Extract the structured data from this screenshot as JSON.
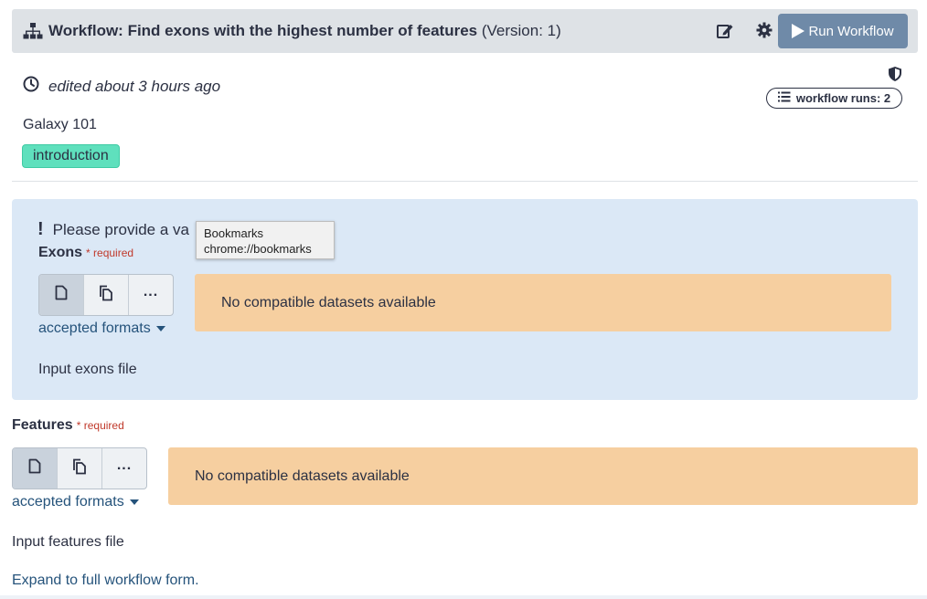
{
  "header": {
    "title": "Workflow: Find exons with the highest number of features",
    "version": "(Version: 1)",
    "run_label": "Run Workflow"
  },
  "meta": {
    "edited": "edited about 3 hours ago",
    "runs_badge": "workflow runs: 2",
    "creator": "Galaxy 101",
    "tag": "introduction"
  },
  "notice": {
    "text": "Please provide a va"
  },
  "tooltip": {
    "line1": "Bookmarks",
    "line2": "chrome://bookmarks"
  },
  "inputs": [
    {
      "label": "Exons",
      "required": "required",
      "formats": "accepted formats",
      "empty_message": "No compatible datasets available",
      "help": "Input exons file"
    },
    {
      "label": "Features",
      "required": "required",
      "formats": "accepted formats",
      "empty_message": "No compatible datasets available",
      "help": "Input features file"
    }
  ],
  "expand_link": "Expand to full workflow form.",
  "colors": {
    "header_bg": "#dee2e6",
    "run_button": "#6f8aa8",
    "panel_bg": "#dbe8f6",
    "warning_bg": "#f6cfa0",
    "tag_bg": "#5fe0bd",
    "link": "#25537b",
    "required": "#c0392b"
  }
}
